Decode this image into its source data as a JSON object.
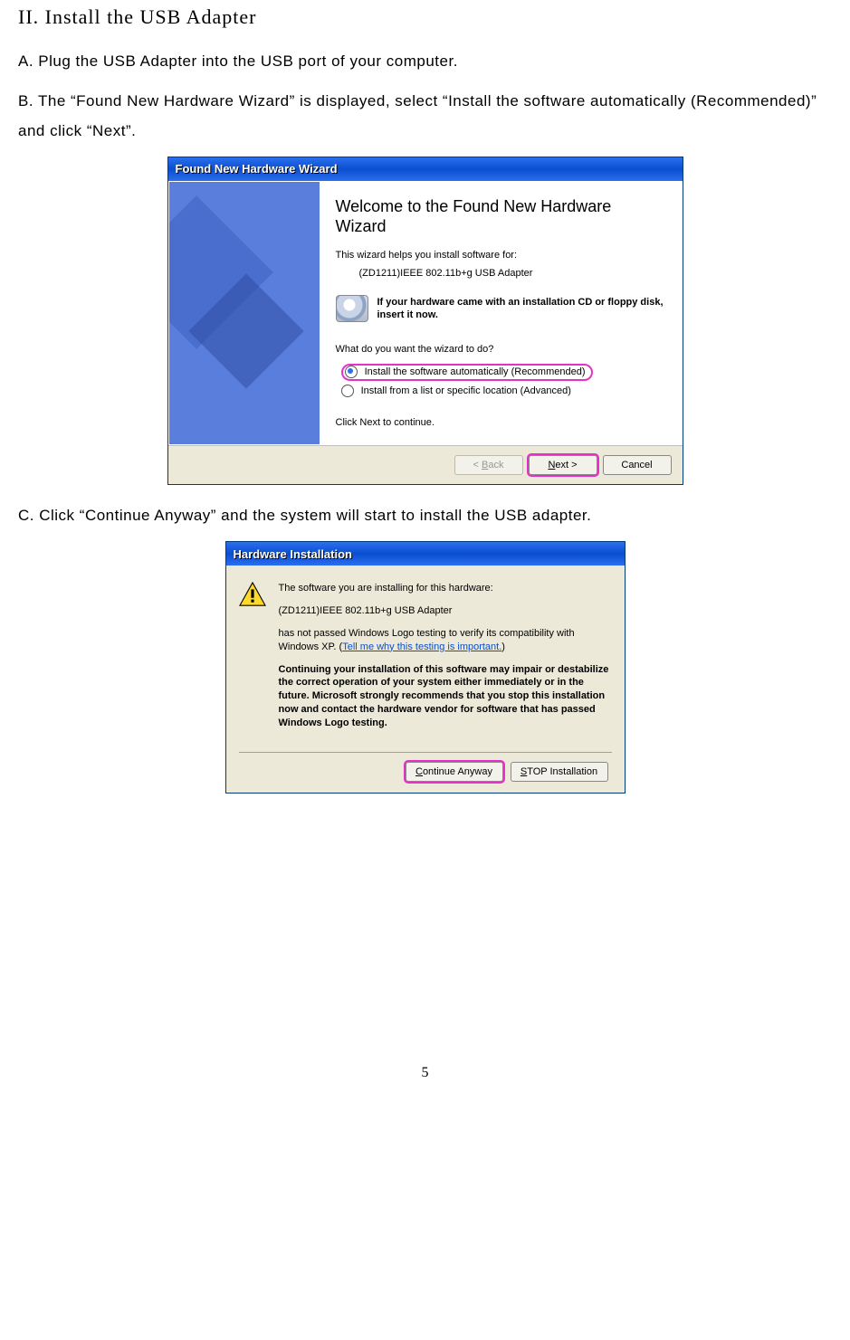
{
  "section_title": "II. Install the USB Adapter",
  "steps": {
    "a": "A. Plug the USB Adapter into the USB port of your computer.",
    "b": "B. The “Found New Hardware Wizard” is displayed, select “Install the software automatically (Recommended)” and click “Next”.",
    "c": "C. Click “Continue Anyway” and the system will start to install the USB adapter."
  },
  "wizard": {
    "title": "Found New Hardware Wizard",
    "heading": "Welcome to the Found New Hardware Wizard",
    "helps_text": "This wizard helps you install software for:",
    "device": "(ZD1211)IEEE 802.11b+g USB Adapter",
    "cd_text": "If your hardware came with an installation CD or floppy disk, insert it now.",
    "question": "What do you want the wizard to do?",
    "opt_auto": "Install the software automatically (Recommended)",
    "opt_list": "Install from a list or specific location (Advanced)",
    "click_next": "Click Next to continue.",
    "buttons": {
      "back": "< Back",
      "next": "Next >",
      "cancel": "Cancel"
    }
  },
  "hw": {
    "title": "Hardware Installation",
    "line1": "The software you are installing for this hardware:",
    "device": "(ZD1211)IEEE 802.11b+g USB Adapter",
    "logo_pre": "has not passed Windows Logo testing to verify its compatibility with Windows XP. (",
    "logo_link": "Tell me why this testing is important.",
    "logo_post": ")",
    "warn_bold": "Continuing your installation of this software may impair or destabilize the correct operation of your system either immediately or in the future. Microsoft strongly recommends that you stop this installation now and contact the hardware vendor for software that has passed Windows Logo testing.",
    "buttons": {
      "continue": "Continue Anyway",
      "stop": "STOP Installation"
    }
  },
  "page_number": "5"
}
